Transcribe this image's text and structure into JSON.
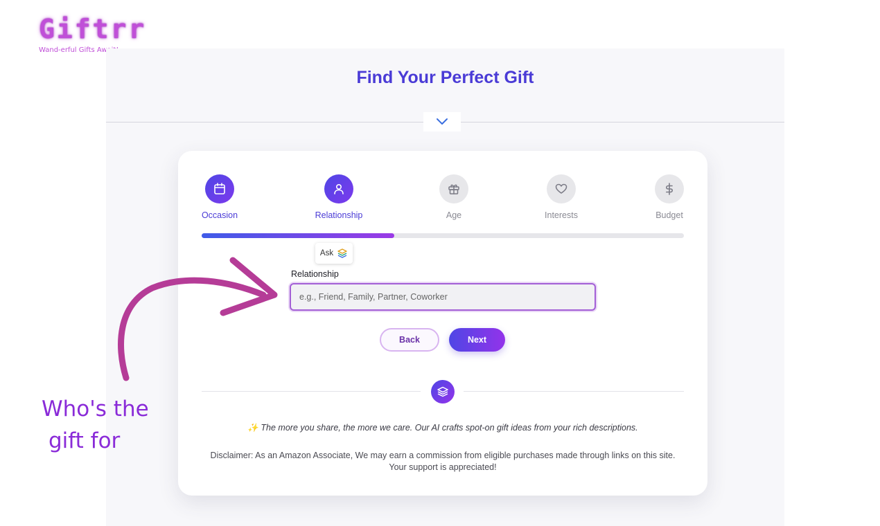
{
  "brand": {
    "name": "Giftrr",
    "tagline": "Wand-erful Gifts Await!",
    "color": "#c04fd8"
  },
  "header": {
    "title": "Find Your Perfect Gift",
    "toggle_icon": "chevron-down-icon"
  },
  "steps": [
    {
      "label": "Occasion",
      "icon": "calendar-icon",
      "state": "done"
    },
    {
      "label": "Relationship",
      "icon": "user-icon",
      "state": "active"
    },
    {
      "label": "Age",
      "icon": "gift-icon",
      "state": "pending"
    },
    {
      "label": "Interests",
      "icon": "heart-icon",
      "state": "pending"
    },
    {
      "label": "Budget",
      "icon": "dollar-icon",
      "state": "pending"
    }
  ],
  "progress": {
    "fraction": 0.4
  },
  "ask_badge": {
    "label": "Ask"
  },
  "form": {
    "field_label": "Relationship",
    "value": "",
    "placeholder": "e.g., Friend, Family, Partner, Coworker"
  },
  "buttons": {
    "back": "Back",
    "next": "Next"
  },
  "info": "✨ The more you share, the more we care. Our AI crafts spot-on gift ideas from your rich descriptions.",
  "disclaimer": "Disclaimer: As an Amazon Associate, We may earn a commission from eligible purchases made through links on this site. Your support is appreciated!",
  "annotation": {
    "line1": "Who's the",
    "line2": "gift for"
  },
  "colors": {
    "accent": "#4a3bd6",
    "accent_purple": "#9333ea",
    "annotation": "#8a2bd8",
    "arrow": "#b53c97"
  }
}
